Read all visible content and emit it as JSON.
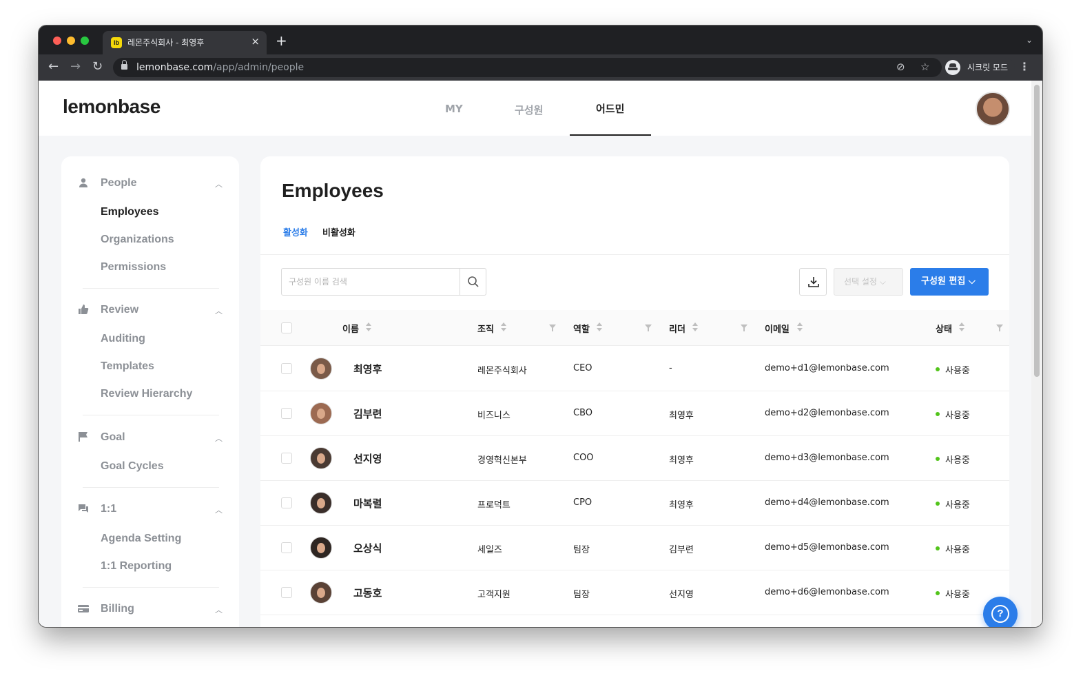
{
  "browser": {
    "tab_favicon": "lb",
    "tab_title": "레몬주식회사 - 최영후",
    "tab_close": "×",
    "new_tab": "+",
    "url_host": "lemonbase.com",
    "url_path": "/app/admin/people",
    "incognito_label": "시크릿 모드"
  },
  "header": {
    "logo": "lemonbase",
    "nav": [
      {
        "label": "MY"
      },
      {
        "label": "구성원"
      },
      {
        "label": "어드민",
        "active": true
      }
    ]
  },
  "sidebar": {
    "sections": [
      {
        "label": "People",
        "icon": "person-icon",
        "items": [
          "Employees",
          "Organizations",
          "Permissions"
        ],
        "active_item": "Employees"
      },
      {
        "label": "Review",
        "icon": "thumbs-up-icon",
        "items": [
          "Auditing",
          "Templates",
          "Review Hierarchy"
        ]
      },
      {
        "label": "Goal",
        "icon": "flag-icon",
        "items": [
          "Goal Cycles"
        ]
      },
      {
        "label": "1:1",
        "icon": "chat-icon",
        "items": [
          "Agenda Setting",
          "1:1 Reporting"
        ]
      },
      {
        "label": "Billing",
        "icon": "card-icon",
        "items": []
      }
    ]
  },
  "main": {
    "title": "Employees",
    "tabs": [
      {
        "label": "활성화",
        "active": true
      },
      {
        "label": "비활성화"
      }
    ],
    "search_placeholder": "구성원 이름 검색",
    "select_setting_label": "선택 설정",
    "edit_button_label": "구성원 편집",
    "accent_color": "#2b7de9",
    "columns": [
      "이름",
      "조직",
      "역할",
      "리더",
      "이메일",
      "상태"
    ],
    "rows": [
      {
        "name": "최영후",
        "org": "레몬주식회사",
        "role": "CEO",
        "leader": "-",
        "email": "demo+d1@lemonbase.com",
        "status": "사용중"
      },
      {
        "name": "김부련",
        "org": "비즈니스",
        "role": "CBO",
        "leader": "최영후",
        "email": "demo+d2@lemonbase.com",
        "status": "사용중"
      },
      {
        "name": "선지영",
        "org": "경영혁신본부",
        "role": "COO",
        "leader": "최영후",
        "email": "demo+d3@lemonbase.com",
        "status": "사용중"
      },
      {
        "name": "마복렬",
        "org": "프로덕트",
        "role": "CPO",
        "leader": "최영후",
        "email": "demo+d4@lemonbase.com",
        "status": "사용중"
      },
      {
        "name": "오상식",
        "org": "세일즈",
        "role": "팀장",
        "leader": "김부련",
        "email": "demo+d5@lemonbase.com",
        "status": "사용중"
      },
      {
        "name": "고동호",
        "org": "고객지원",
        "role": "팀장",
        "leader": "선지영",
        "email": "demo+d6@lemonbase.com",
        "status": "사용중"
      }
    ],
    "status_color": "#52c41a"
  },
  "help_label": "?"
}
